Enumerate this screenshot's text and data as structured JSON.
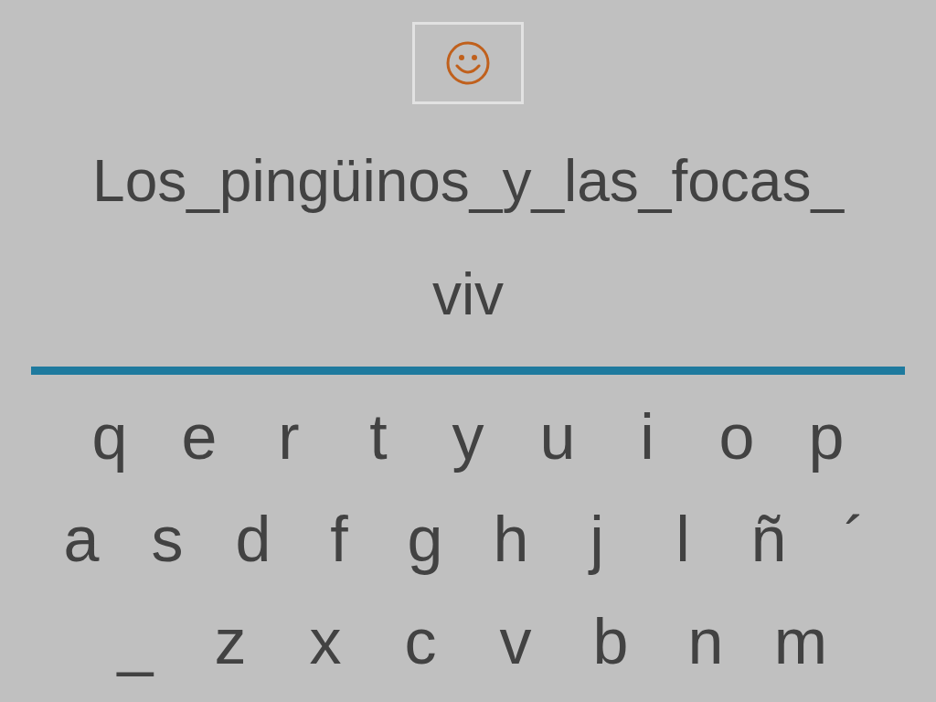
{
  "sentence_lines": [
    "Los_pingüinos_y_las_focas_",
    "viv"
  ],
  "keyboard": [
    [
      "q",
      "e",
      "r",
      "t",
      "y",
      "u",
      "i",
      "o",
      "p"
    ],
    [
      "a",
      "s",
      "d",
      "f",
      "g",
      "h",
      "j",
      "l",
      "ñ",
      "´"
    ],
    [
      "_",
      "z",
      "x",
      "c",
      "v",
      "b",
      "n",
      "m"
    ]
  ]
}
